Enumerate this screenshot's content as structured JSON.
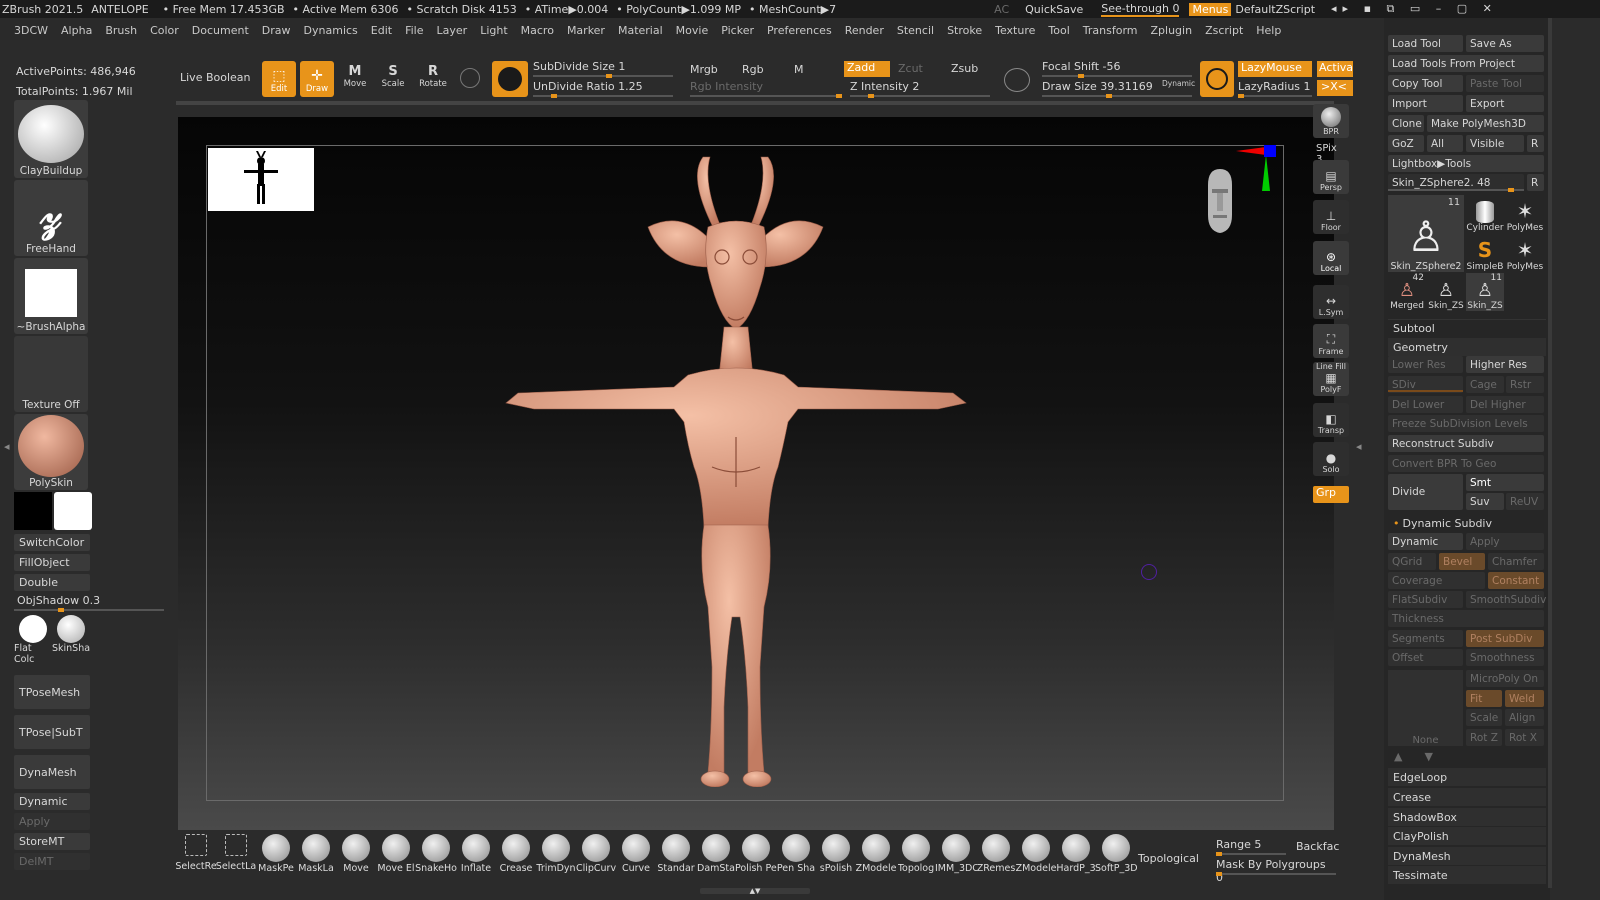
{
  "titlebar": {
    "app": "ZBrush 2021.5",
    "project": "ANTELOPE",
    "free_mem": "• Free Mem 17.453GB",
    "active_mem": "• Active Mem 6306",
    "scratch": "• Scratch Disk 4153",
    "atime": "• ATime▶0.004",
    "polycount": "• PolyCount▶1.099 MP",
    "meshcount": "• MeshCount▶7",
    "ac": "AC",
    "quicksave": "QuickSave",
    "seethrough": "See-through  0",
    "menus": "Menus",
    "script": "DefaultZScript"
  },
  "menubar": [
    "3DCW",
    "Alpha",
    "Brush",
    "Color",
    "Document",
    "Draw",
    "Dynamics",
    "Edit",
    "File",
    "Layer",
    "Light",
    "Macro",
    "Marker",
    "Material",
    "Movie",
    "Picker",
    "Preferences",
    "Render",
    "Stencil",
    "Stroke",
    "Texture",
    "Tool",
    "Transform",
    "Zplugin",
    "Zscript",
    "Help"
  ],
  "stats": {
    "active_points": "ActivePoints: 486,946",
    "total_points": "TotalPoints: 1.967 Mil"
  },
  "toolbar": {
    "live_boolean": "Live Boolean",
    "edit": "Edit",
    "draw": "Draw",
    "move": "Move",
    "scale": "Scale",
    "rotate": "Rotate",
    "subdivide_size": "SubDivide Size 1",
    "undivide_ratio": "UnDivide Ratio 1.25",
    "mrgb": "Mrgb",
    "rgb": "Rgb",
    "m": "M",
    "rgb_intensity": "Rgb Intensity",
    "zadd": "Zadd",
    "zcut": "Zcut",
    "zsub": "Zsub",
    "z_intensity": "Z Intensity 2",
    "focal_shift": "Focal Shift -56",
    "draw_size": "Draw Size 39.31169",
    "dynamic": "Dynamic",
    "lazymouse": "LazyMouse",
    "lazyradius": "LazyRadius 1",
    "activate": "Activate",
    "xc": ">X<"
  },
  "left": {
    "brush1": "ClayBuildup",
    "brush2": "FreeHand",
    "alpha": "~BrushAlpha",
    "texture": "Texture Off",
    "material": "PolySkin",
    "switchcolor": "SwitchColor",
    "fillobject": "FillObject",
    "double": "Double",
    "objshadow": "ObjShadow",
    "objshadow_val": "0.3",
    "flatcolor": "Flat Colc",
    "skinshade": "SkinSha",
    "tposemesh": "TPoseMesh",
    "tposesubt": "TPose|SubT",
    "dynamesh": "DynaMesh",
    "dynamic": "Dynamic",
    "apply": "Apply",
    "storemt": "StoreMT",
    "delmt": "DelMT"
  },
  "right_tools": {
    "bpr": "BPR",
    "spix": "SPix 3",
    "persp": "Persp",
    "floor": "Floor",
    "local": "Local",
    "lsym": "L.Sym",
    "frame": "Frame",
    "linefill": "Line Fill",
    "polyf": "PolyF",
    "transp": "Transp",
    "solo": "Solo",
    "grp": "Grp"
  },
  "tool_panel": {
    "title": "Tool",
    "load_tool": "Load Tool",
    "save_as": "Save As",
    "load_from_project": "Load Tools From Project",
    "copy_tool": "Copy Tool",
    "paste_tool": "Paste Tool",
    "import": "Import",
    "export": "Export",
    "clone": "Clone",
    "make_polymesh": "Make PolyMesh3D",
    "goz": "GoZ",
    "all": "All",
    "visible": "Visible",
    "r": "R",
    "lightbox": "Lightbox▶Tools",
    "current_tool": "Skin_ZSphere2. 48",
    "thumbs": [
      "Skin_ZSphere2",
      "Cylinder",
      "PolyMes",
      "SimpleB",
      "PolyMes",
      "Merged",
      "Skin_ZS",
      "Skin_ZS"
    ],
    "thumb_counts": [
      "11",
      "42",
      "11"
    ],
    "subtool": "Subtool",
    "geometry": "Geometry",
    "lower_res": "Lower Res",
    "higher_res": "Higher Res",
    "sdiv": "SDiv",
    "cage": "Cage",
    "rstr": "Rstr",
    "del_lower": "Del Lower",
    "del_higher": "Del Higher",
    "freeze": "Freeze SubDivision Levels",
    "reconstruct": "Reconstruct Subdiv",
    "convert_bpr": "Convert BPR To Geo",
    "divide": "Divide",
    "smt": "Smt",
    "suv": "Suv",
    "reuv": "ReUV",
    "dynamic_subdiv": "Dynamic Subdiv",
    "dynamic": "Dynamic",
    "apply": "Apply",
    "qgrid": "QGrid",
    "bevel": "Bevel",
    "chamfer": "Chamfer",
    "coverage": "Coverage",
    "constant": "Constant",
    "flatsubdiv": "FlatSubdiv",
    "smoothsubdiv": "SmoothSubdiv",
    "thickness": "Thickness",
    "segments": "Segments",
    "post_subdiv": "Post SubDiv",
    "offset": "Offset",
    "smoothness": "Smoothness",
    "micropoly": "MicroPoly On",
    "fit": "Fit",
    "weld": "Weld",
    "scale": "Scale",
    "align": "Align",
    "none": "None",
    "rotz": "Rot Z",
    "rotx": "Rot X",
    "edgeloop": "EdgeLoop",
    "crease": "Crease",
    "shadowbox": "ShadowBox",
    "claypolish": "ClayPolish",
    "dynamesh": "DynaMesh",
    "tessimate": "Tessimate"
  },
  "bottom_brushes": [
    "SelectRe",
    "SelectLa",
    "MaskPe",
    "MaskLa",
    "Move",
    "Move El",
    "SnakeHo",
    "Inflate",
    "Crease",
    "TrimDyn",
    "ClipCurv",
    "Curve",
    "Standar",
    "DamSta",
    "Polish Pen A",
    "Pen Sha",
    "sPolish",
    "ZModele",
    "Topolog",
    "IMM_3DC",
    "ZRemes",
    "ZModele",
    "HardP_3",
    "SoftP_3D"
  ],
  "bottom_right": {
    "topological": "Topological",
    "range": "Range 5",
    "backface": "Backfac",
    "mask_polygroups": "Mask By Polygroups 0"
  },
  "colors": {
    "accent": "#e8941a",
    "skin": "#e8a88c",
    "canvas_bg": "#0a0a0a"
  }
}
